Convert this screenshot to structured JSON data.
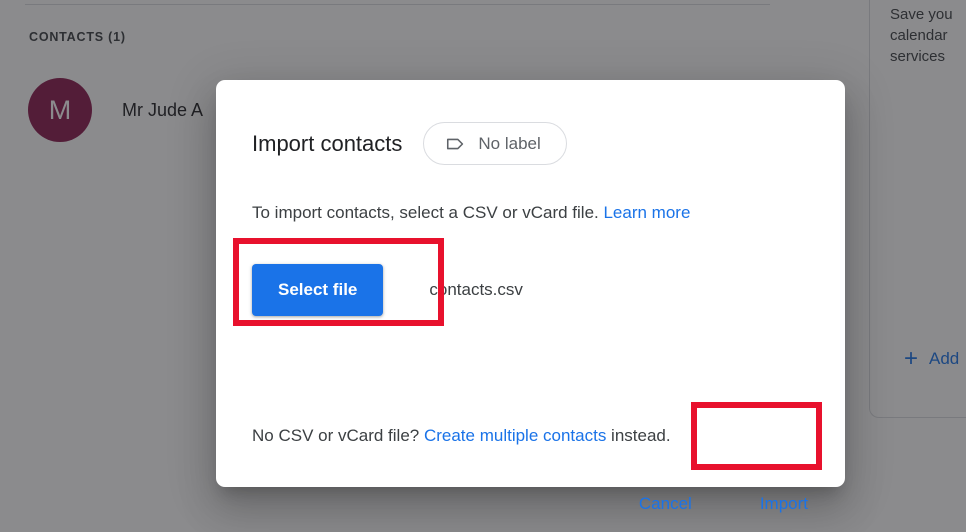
{
  "background": {
    "contacts_heading": "CONTACTS (1)",
    "contact": {
      "avatar_initial": "M",
      "avatar_color": "#8b1a4f",
      "name": "Mr Jude A"
    },
    "side_panel": {
      "promo_text": "Save you calendar services",
      "add_label": "+ Add",
      "plus_icon": "+"
    }
  },
  "dialog": {
    "title": "Import contacts",
    "label_chip": {
      "icon": "tag-icon",
      "text": "No label"
    },
    "description_prefix": "To import contacts, select a CSV or vCard file. ",
    "description_link": "Learn more",
    "select_file_label": "Select file",
    "selected_file_name": "contacts.csv",
    "alt_prefix": "No CSV or vCard file? ",
    "alt_link": "Create multiple contacts",
    "alt_suffix": " instead.",
    "cancel_label": "Cancel",
    "import_label": "Import"
  },
  "colors": {
    "accent_blue": "#1a73e8",
    "annotation_red": "#e8112d",
    "text_primary": "#202124",
    "text_secondary": "#3c4043",
    "chip_text": "#5f6368"
  }
}
